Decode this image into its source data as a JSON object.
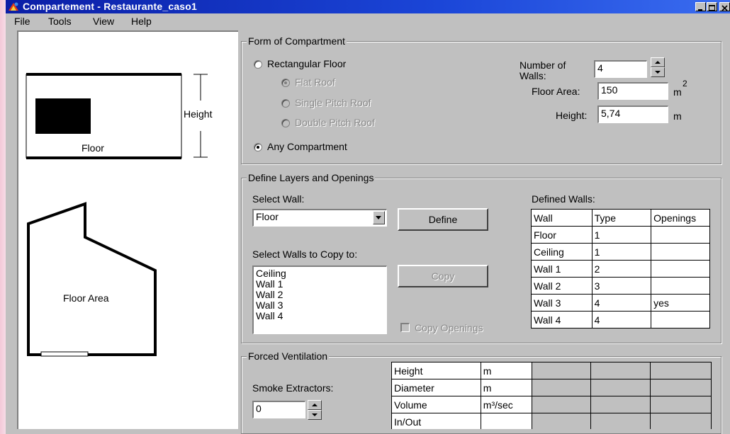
{
  "window": {
    "title": "Compartement - Restaurante_caso1"
  },
  "menu": {
    "file": "File",
    "tools": "Tools",
    "view": "View",
    "help": "Help"
  },
  "drawing": {
    "floor_label": "Floor",
    "height_label": "Height",
    "floor_area_label": "Floor Area"
  },
  "form": {
    "group_title": "Form of Compartment",
    "rectangular_floor": "Rectangular Floor",
    "flat_roof": "Flat Roof",
    "single_pitch_roof": "Single Pitch Roof",
    "double_pitch_roof": "Double Pitch Roof",
    "any_compartment": "Any Compartment",
    "selected": "any_compartment",
    "number_of_walls_label": "Number of Walls:",
    "number_of_walls_value": "4",
    "floor_area_label": "Floor Area:",
    "floor_area_value": "150",
    "floor_area_unit": "m",
    "floor_area_unit_exp": "2",
    "height_label": "Height:",
    "height_value": "5,74",
    "height_unit": "m"
  },
  "layers": {
    "group_title": "Define Layers and Openings",
    "select_wall_label": "Select Wall:",
    "select_wall_value": "Floor",
    "define_button": "Define",
    "copy_to_label": "Select Walls to Copy to:",
    "copy_list": [
      "Ceiling",
      "Wall 1",
      "Wall 2",
      "Wall 3",
      "Wall 4"
    ],
    "copy_button": "Copy",
    "copy_openings_label": "Copy Openings",
    "copy_openings_checked": false,
    "defined_walls_label": "Defined Walls:",
    "defined_walls_headers": [
      "Wall",
      "Type",
      "Openings"
    ],
    "defined_walls_rows": [
      [
        "Floor",
        "1",
        ""
      ],
      [
        "Ceiling",
        "1",
        ""
      ],
      [
        "Wall 1",
        "2",
        ""
      ],
      [
        "Wall 2",
        "3",
        ""
      ],
      [
        "Wall 3",
        "4",
        "yes"
      ],
      [
        "Wall 4",
        "4",
        ""
      ]
    ]
  },
  "ventilation": {
    "group_title": "Forced Ventilation",
    "smoke_extractors_label": "Smoke Extractors:",
    "smoke_extractors_value": "0",
    "table_rows": [
      [
        "Height",
        "m",
        "",
        "",
        ""
      ],
      [
        "Diameter",
        "m",
        "",
        "",
        ""
      ],
      [
        "Volume",
        "m³/sec",
        "",
        "",
        ""
      ],
      [
        "In/Out",
        "",
        "",
        "",
        ""
      ]
    ]
  },
  "colors": {
    "titlebar_start": "#0a1ea6",
    "titlebar_end": "#3a6cf0",
    "window_face": "#c0c0c0",
    "desktop_strip": "#f3c9d8"
  }
}
